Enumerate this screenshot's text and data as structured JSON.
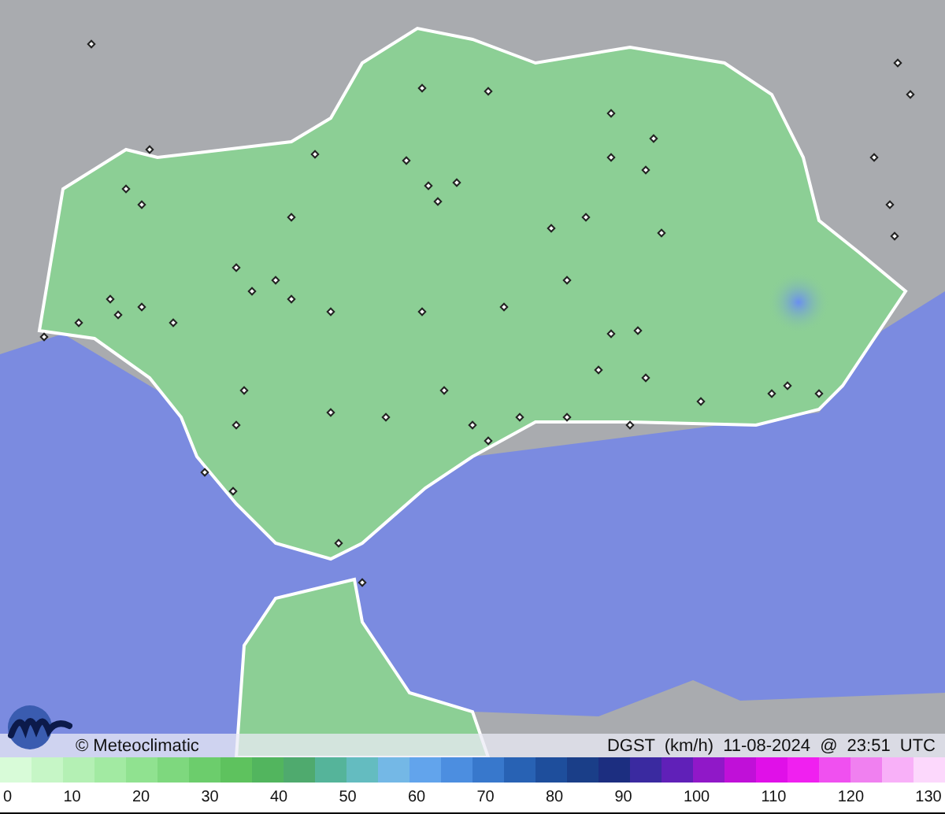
{
  "caption": {
    "copyright": "© Meteoclimatic",
    "title": "DGST (km/h) 11-08-2024 @ 23:51 UTC"
  },
  "legend": {
    "ticks": [
      "0",
      "10",
      "20",
      "30",
      "40",
      "50",
      "60",
      "70",
      "80",
      "90",
      "100",
      "110",
      "120",
      "130"
    ]
  }
}
